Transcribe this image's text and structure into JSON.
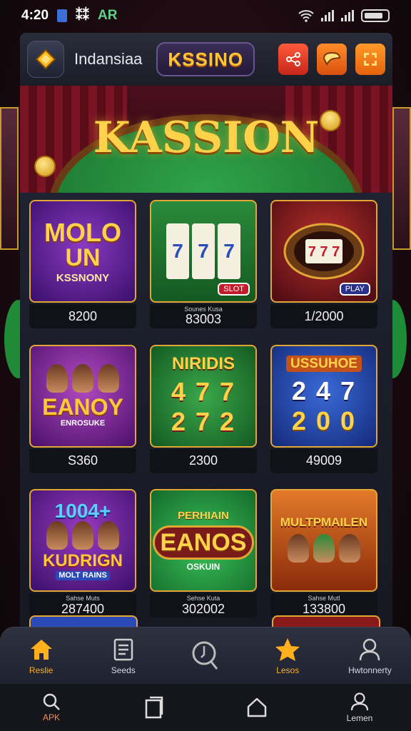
{
  "status_bar": {
    "time": "4:20",
    "glyph": "⁑⁑",
    "carrier": "AR"
  },
  "app_bar": {
    "brand": "Indansiaa",
    "pill_label": "KSSINO",
    "icons": [
      "share-icon",
      "chat-icon",
      "expand-icon"
    ]
  },
  "hero": {
    "title": "KASSION"
  },
  "games": [
    {
      "line1": "MOLO",
      "line2": "UN",
      "line3": "KSSNONY",
      "price": "8200",
      "bg": "#5a1f8a"
    },
    {
      "line1": "",
      "reel": [
        "7",
        "7",
        "7"
      ],
      "badge": "SLOT",
      "sub": "Sounes Kusa",
      "price": "83003",
      "bg": "#1f6e2c"
    },
    {
      "line1": "",
      "badge": "PLAY",
      "price": "1/2000",
      "bg": "#6a1520"
    },
    {
      "line1": "EANOY",
      "line2": "ENROSUKE",
      "price": "S360",
      "bg": "#7a2a9a"
    },
    {
      "line1": "NIRIDIS",
      "digits": "4 7 7",
      "digits2": "2 7 2",
      "price": "2300",
      "bg": "#1f7a2c"
    },
    {
      "line1": "USSUHOE",
      "digits": "2 4 7",
      "digits2": "2 0 0",
      "price": "49009",
      "bg": "#1f3e9a"
    },
    {
      "line1": "1004+",
      "line2": "KUDRIGN",
      "line3": "MOLT RAINS",
      "sub": "Sahse Muts",
      "price": "287400",
      "bg": "#5a1f8a"
    },
    {
      "line1": "PERHIAIN",
      "line2": "EANOS",
      "line3": "OSKUIN",
      "sub": "Sehse Kuta",
      "price": "302002",
      "bg": "#1f8a3a"
    },
    {
      "line1": "MULTPMAILEN",
      "sub": "Sahse Mutl",
      "price": "133800",
      "bg": "#c2521a"
    }
  ],
  "bottom_nav": [
    {
      "label": "Reslie",
      "icon": "home-icon"
    },
    {
      "label": "Seeds",
      "icon": "document-icon"
    },
    {
      "label": "",
      "icon": "search-icon"
    },
    {
      "label": "Lesos",
      "icon": "star-icon"
    },
    {
      "label": "Hwtonnerty",
      "icon": "profile-icon"
    }
  ],
  "system_nav": [
    {
      "label": "APK",
      "icon": "search-icon"
    },
    {
      "label": "",
      "icon": "recent-apps-icon"
    },
    {
      "label": "",
      "icon": "home-icon"
    },
    {
      "label": "Lemen",
      "icon": "user-icon"
    }
  ],
  "colors": {
    "accent_gold": "#ffc53a",
    "card_border": "#e2a634",
    "brand_red": "#c7261a"
  }
}
